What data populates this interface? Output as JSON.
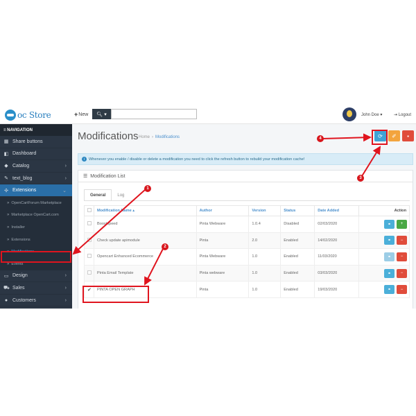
{
  "header": {
    "logo_text": "oc Store",
    "new_label": "New",
    "user_name": "John Doe",
    "logout_label": "Logout"
  },
  "sidebar": {
    "heading": "NAVIGATION",
    "items": [
      {
        "label": "Share buttons",
        "icon": "grid-icon"
      },
      {
        "label": "Dashboard",
        "icon": "dashboard-icon"
      },
      {
        "label": "Catalog",
        "icon": "tag-icon"
      },
      {
        "label": "text_blog",
        "icon": "pencil-icon"
      },
      {
        "label": "Extensions",
        "icon": "puzzle-icon"
      }
    ],
    "sub_items": [
      "OpenCartForum Marketplace",
      "Marketplace OpenCart.com",
      "Installer",
      "Extensions",
      "Modifications",
      "Events"
    ],
    "bottom_items": [
      {
        "label": "Design",
        "icon": "monitor-icon"
      },
      {
        "label": "Sales",
        "icon": "cart-icon"
      },
      {
        "label": "Customers",
        "icon": "user-icon"
      }
    ]
  },
  "page": {
    "title": "Modifications",
    "breadcrumb_home": "Home",
    "breadcrumb_sep": "›",
    "breadcrumb_current": "Modifications"
  },
  "alert": {
    "text": "Whenever you enable / disable or delete a modification you need to click the refresh button to rebuild your modification cache!"
  },
  "panel": {
    "title": "Modification List",
    "tabs": [
      "General",
      "Log"
    ]
  },
  "table": {
    "headers": {
      "name": "Modification Name ▴",
      "author": "Author",
      "version": "Version",
      "status": "Status",
      "date": "Date Added",
      "action": "Action"
    },
    "rows": [
      {
        "name": "Boostspeed",
        "author": "Pinta Webware",
        "version": "1.0.4",
        "status": "Disabled",
        "date": "02/03/2020",
        "checked": false
      },
      {
        "name": "Check update apimodule",
        "author": "Pinta",
        "version": "2.0",
        "status": "Enabled",
        "date": "14/02/2020",
        "checked": false
      },
      {
        "name": "Opencart Enhanced Ecommerce",
        "author": "Pinta Webware",
        "version": "1.0",
        "status": "Enabled",
        "date": "11/03/2020",
        "checked": false
      },
      {
        "name": "Pinta Email Template",
        "author": "Pinta webware",
        "version": "1.0",
        "status": "Enabled",
        "date": "03/03/2020",
        "checked": false
      },
      {
        "name": "PINTA OPEN GRAPH",
        "author": "Pinta",
        "version": "1.0",
        "status": "Enabled",
        "date": "19/03/2020",
        "checked": true
      }
    ]
  },
  "annotations": {
    "markers": [
      "1",
      "2",
      "3",
      "4"
    ],
    "color": "#e0141e"
  },
  "colors": {
    "sidebar_bg": "#2b3644",
    "active_nav": "#2a6fa8",
    "refresh_btn": "#3fa3d6",
    "clear_btn": "#f3a43d",
    "delete_btn": "#e04c3b",
    "enable_btn": "#49a845"
  }
}
